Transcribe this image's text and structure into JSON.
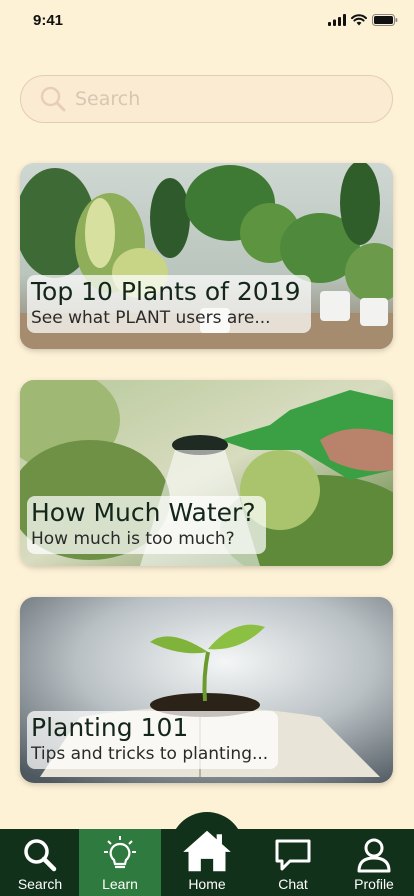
{
  "status_bar": {
    "time": "9:41",
    "icons": [
      "cellular-signal-icon",
      "wifi-icon",
      "battery-icon"
    ]
  },
  "search": {
    "placeholder": "Search",
    "value": ""
  },
  "cards": [
    {
      "title": "Top 10 Plants of 2019",
      "subtitle": "See what PLANT users are..."
    },
    {
      "title": "How Much Water?",
      "subtitle": "How much is too much?"
    },
    {
      "title": "Planting 101",
      "subtitle": "Tips and tricks to planting..."
    }
  ],
  "nav": {
    "items": [
      {
        "label": "Search",
        "icon": "search-icon"
      },
      {
        "label": "Learn",
        "icon": "lightbulb-icon",
        "active": true
      },
      {
        "label": "Home",
        "icon": "home-icon"
      },
      {
        "label": "Chat",
        "icon": "chat-icon"
      },
      {
        "label": "Profile",
        "icon": "profile-icon"
      }
    ]
  },
  "colors": {
    "background": "#fdf1d6",
    "nav_background": "#12311a",
    "nav_active": "#2f7a3e",
    "accent_green": "#2f7a3e"
  }
}
